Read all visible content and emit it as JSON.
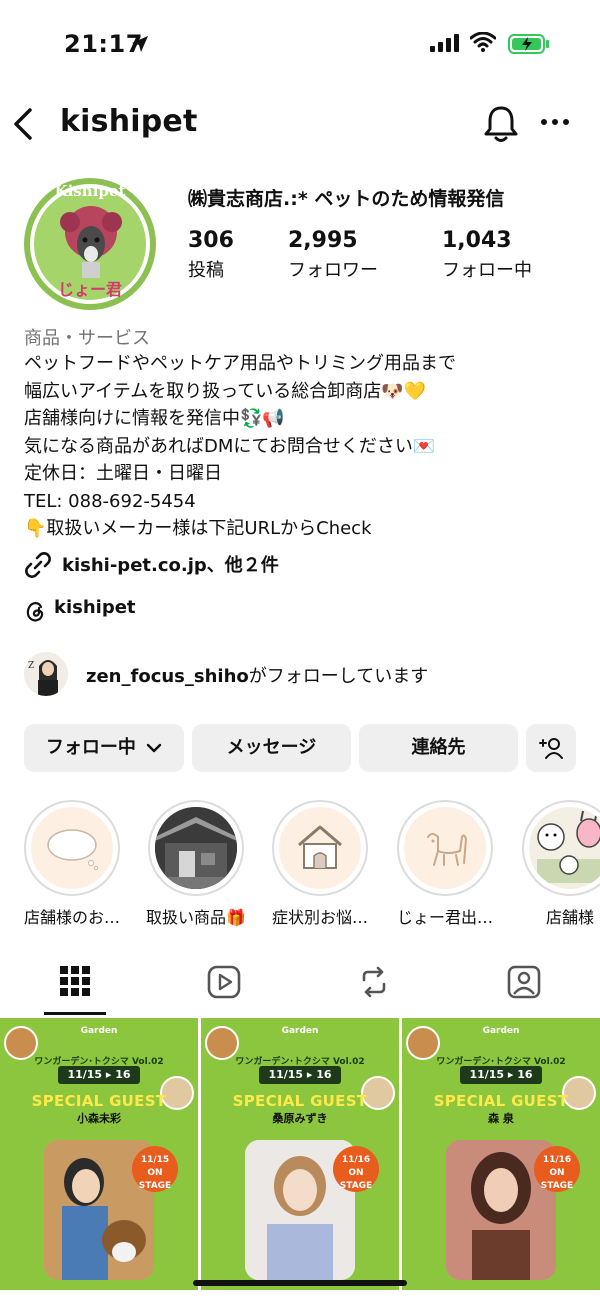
{
  "status_bar": {
    "time": "21:17"
  },
  "header": {
    "username": "kishipet"
  },
  "profile": {
    "avatar_top_text": "Kishipet",
    "avatar_bottom_text": "じょー君",
    "display_name": "㈱貴志商店.:* ペットのため情報発信",
    "stats": [
      {
        "value": "306",
        "label": "投稿"
      },
      {
        "value": "2,995",
        "label": "フォロワー"
      },
      {
        "value": "1,043",
        "label": "フォロー中"
      }
    ],
    "category": "商品・サービス",
    "bio_lines": [
      "ペットフードやペットケア用品やトリミング用品まで",
      "幅広いアイテムを取り扱っている総合卸商店🐶💛",
      "店舗様向けに情報を発信中💱📢",
      "気になる商品があればDMにてお問合せください💌",
      "定休日：土曜日・日曜日",
      "TEL: 088-692-5454",
      "👇取扱いメーカー様は下記URLからCheck"
    ],
    "link": "kishi-pet.co.jp、他２件",
    "threads": "kishipet",
    "followed_by_user": "zen_focus_shiho",
    "followed_by_suffix": "がフォローしています"
  },
  "actions": {
    "following": "フォロー中",
    "message": "メッセージ",
    "contact": "連絡先"
  },
  "highlights": [
    {
      "label": "店舗様のお…",
      "icon": "speech-bubble-icon"
    },
    {
      "label": "取扱い商品🎁",
      "icon": "warehouse-photo"
    },
    {
      "label": "症状別お悩…",
      "icon": "doghouse-icon"
    },
    {
      "label": "じょー君出…",
      "icon": "dog-outline-icon"
    },
    {
      "label": "店舗様",
      "icon": "character-stickers"
    }
  ],
  "posts": [
    {
      "brand": "Garden",
      "event": "ワンガーデン･トクシマ Vol.02",
      "dates": "11/15 ▸ 16",
      "title": "SPECIAL GUEST",
      "guest": "小森未彩",
      "badge_date": "11/15",
      "badge_text": "ON STAGE",
      "photo_bg": "#d7b17f"
    },
    {
      "brand": "Garden",
      "event": "ワンガーデン･トクシマ Vol.02",
      "dates": "11/15 ▸ 16",
      "title": "SPECIAL GUEST",
      "guest": "桑原みずき",
      "badge_date": "11/16",
      "badge_text": "ON STAGE",
      "photo_bg": "#e9e4e4"
    },
    {
      "brand": "Garden",
      "event": "ワンガーデン･トクシマ Vol.02",
      "dates": "11/15 ▸ 16",
      "title": "SPECIAL GUEST",
      "guest": "森 泉",
      "badge_date": "11/16",
      "badge_text": "ON STAGE",
      "photo_bg": "#d9a08f"
    }
  ],
  "colors": {
    "post_green": "#8cc63e",
    "badge_orange": "#e85c1e",
    "guest_yellow": "#ffe94a"
  }
}
